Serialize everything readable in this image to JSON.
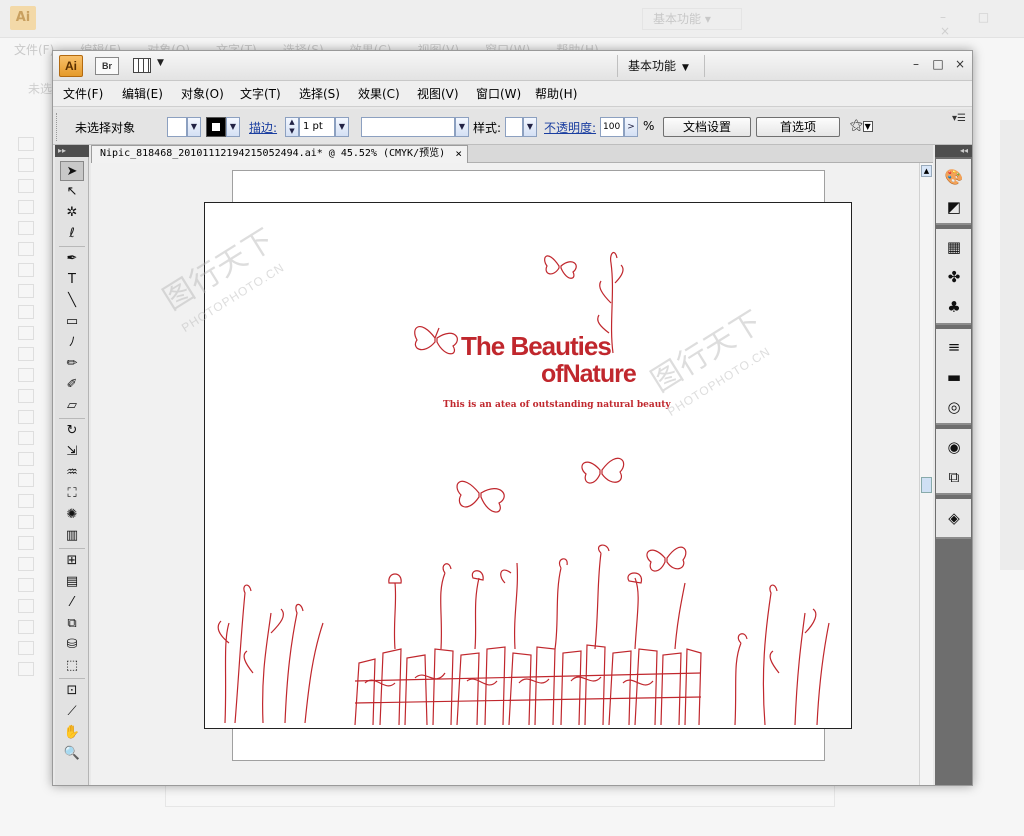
{
  "app": {
    "logo": "Ai",
    "bridge_label": "Br",
    "workspace": "基本功能",
    "window_controls": [
      "–",
      "□",
      "×"
    ]
  },
  "menu": [
    "文件(F)",
    "编辑(E)",
    "对象(O)",
    "文字(T)",
    "选择(S)",
    "效果(C)",
    "视图(V)",
    "窗口(W)",
    "帮助(H)"
  ],
  "controlbar": {
    "selection_status": "未选择对象",
    "stroke_label": "描边:",
    "stroke_weight": "1 pt",
    "style_label": "样式:",
    "opacity_label": "不透明度:",
    "opacity_value": "100",
    "opacity_unit": "%",
    "doc_setup_button": "文档设置",
    "preferences_button": "首选项"
  },
  "document": {
    "tab_title": "Nipic_818468_20101112194215052494.ai* @ 45.52% (CMYK/预览)",
    "tab_close": "×"
  },
  "artwork": {
    "title_line1": "The Beauties",
    "title_line2": "ofNature",
    "subtitle": "This is an atea of outstanding natural beauty",
    "accent_color": "#c0272d"
  },
  "watermark": {
    "chinese": "图行天下",
    "site": "PHOTOPHOTO.CN"
  },
  "background_window": {
    "logo": "Ai",
    "workspace": "基本功能",
    "menu": [
      "文件(F)",
      "编辑(E)",
      "对象(O)",
      "文字(T)",
      "选择(S)",
      "效果(C)",
      "视图(V)",
      "窗口(W)",
      "帮助(H)"
    ],
    "status": "未选"
  },
  "tools": [
    "selection-tool",
    "direct-selection-tool",
    "magic-wand-tool",
    "lasso-tool",
    "pen-tool",
    "type-tool",
    "line-tool",
    "rectangle-tool",
    "paintbrush-tool",
    "pencil-tool",
    "blob-brush-tool",
    "eraser-tool",
    "rotate-tool",
    "scale-tool",
    "warp-tool",
    "free-transform-tool",
    "symbol-sprayer-tool",
    "column-graph-tool",
    "mesh-tool",
    "gradient-tool",
    "eyedropper-tool",
    "blend-tool",
    "live-paint-bucket-tool",
    "live-paint-selection-tool",
    "artboard-tool",
    "slice-tool",
    "hand-tool",
    "zoom-tool"
  ],
  "panels": [
    "color-panel",
    "color-guide-panel",
    "swatches-panel",
    "brushes-panel",
    "symbols-panel",
    "stroke-panel",
    "gradient-panel",
    "transparency-panel",
    "appearance-panel",
    "graphic-styles-panel",
    "layers-panel"
  ]
}
